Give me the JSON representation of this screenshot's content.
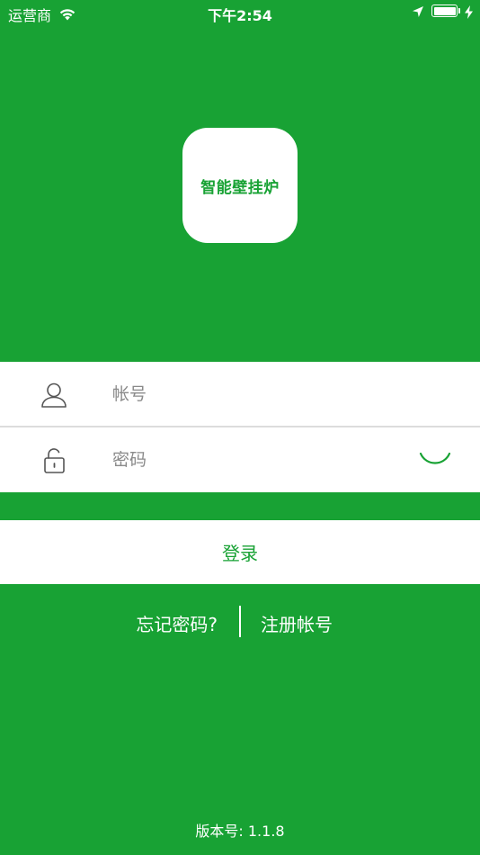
{
  "status_bar": {
    "carrier": "运营商",
    "time": "下午2:54"
  },
  "app_icon": {
    "label": "智能壁挂炉"
  },
  "login_form": {
    "account_placeholder": "帐号",
    "password_placeholder": "密码",
    "account_value": "",
    "password_value": ""
  },
  "login_button": {
    "label": "登录"
  },
  "links": {
    "forgot_password": "忘记密码?",
    "register": "注册帐号"
  },
  "footer": {
    "version": "版本号: 1.1.8"
  },
  "colors": {
    "brand_green": "#18a234",
    "white": "#ffffff",
    "placeholder_gray": "#8a8a8a"
  },
  "icons": {
    "wifi": "wifi-icon",
    "location": "location-arrow-icon",
    "battery": "battery-icon",
    "charging": "charging-bolt-icon",
    "user": "user-icon",
    "lock": "unlock-icon",
    "eye": "eye-closed-icon"
  }
}
